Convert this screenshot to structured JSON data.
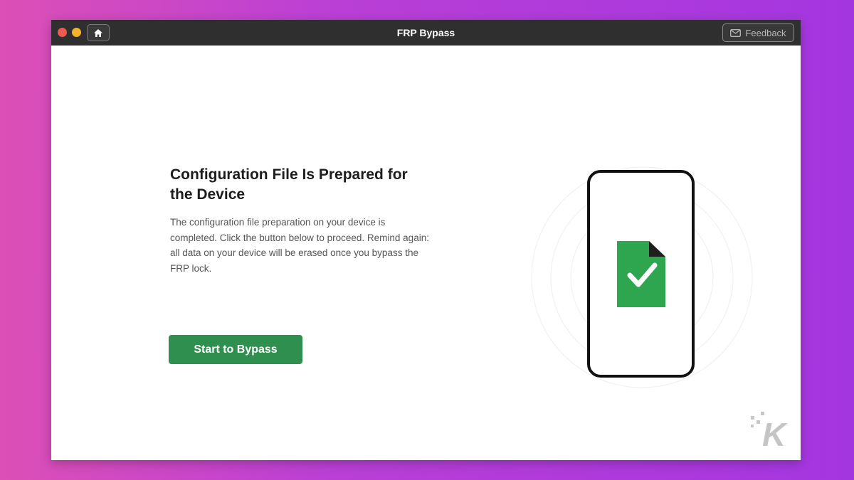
{
  "window": {
    "title": "FRP Bypass",
    "feedback_label": "Feedback",
    "home_icon": "home-icon",
    "feedback_icon": "mail-icon",
    "traffic_light_colors": [
      "#ee5a52",
      "#f3b42a"
    ]
  },
  "main": {
    "heading": "Configuration File Is Prepared for the Device",
    "description": "The configuration file preparation on your device is completed. Click the button below to proceed. Remind again: all data on your device will be erased once you bypass the FRP lock.",
    "primary_button_label": "Start to Bypass"
  },
  "illustration": {
    "icon": "phone-with-checked-file-icon",
    "file_color": "#2ea64f"
  },
  "watermark": {
    "logo": "K"
  },
  "colors": {
    "accent": "#2f8f4e",
    "titlebar": "#2f2f2f"
  }
}
